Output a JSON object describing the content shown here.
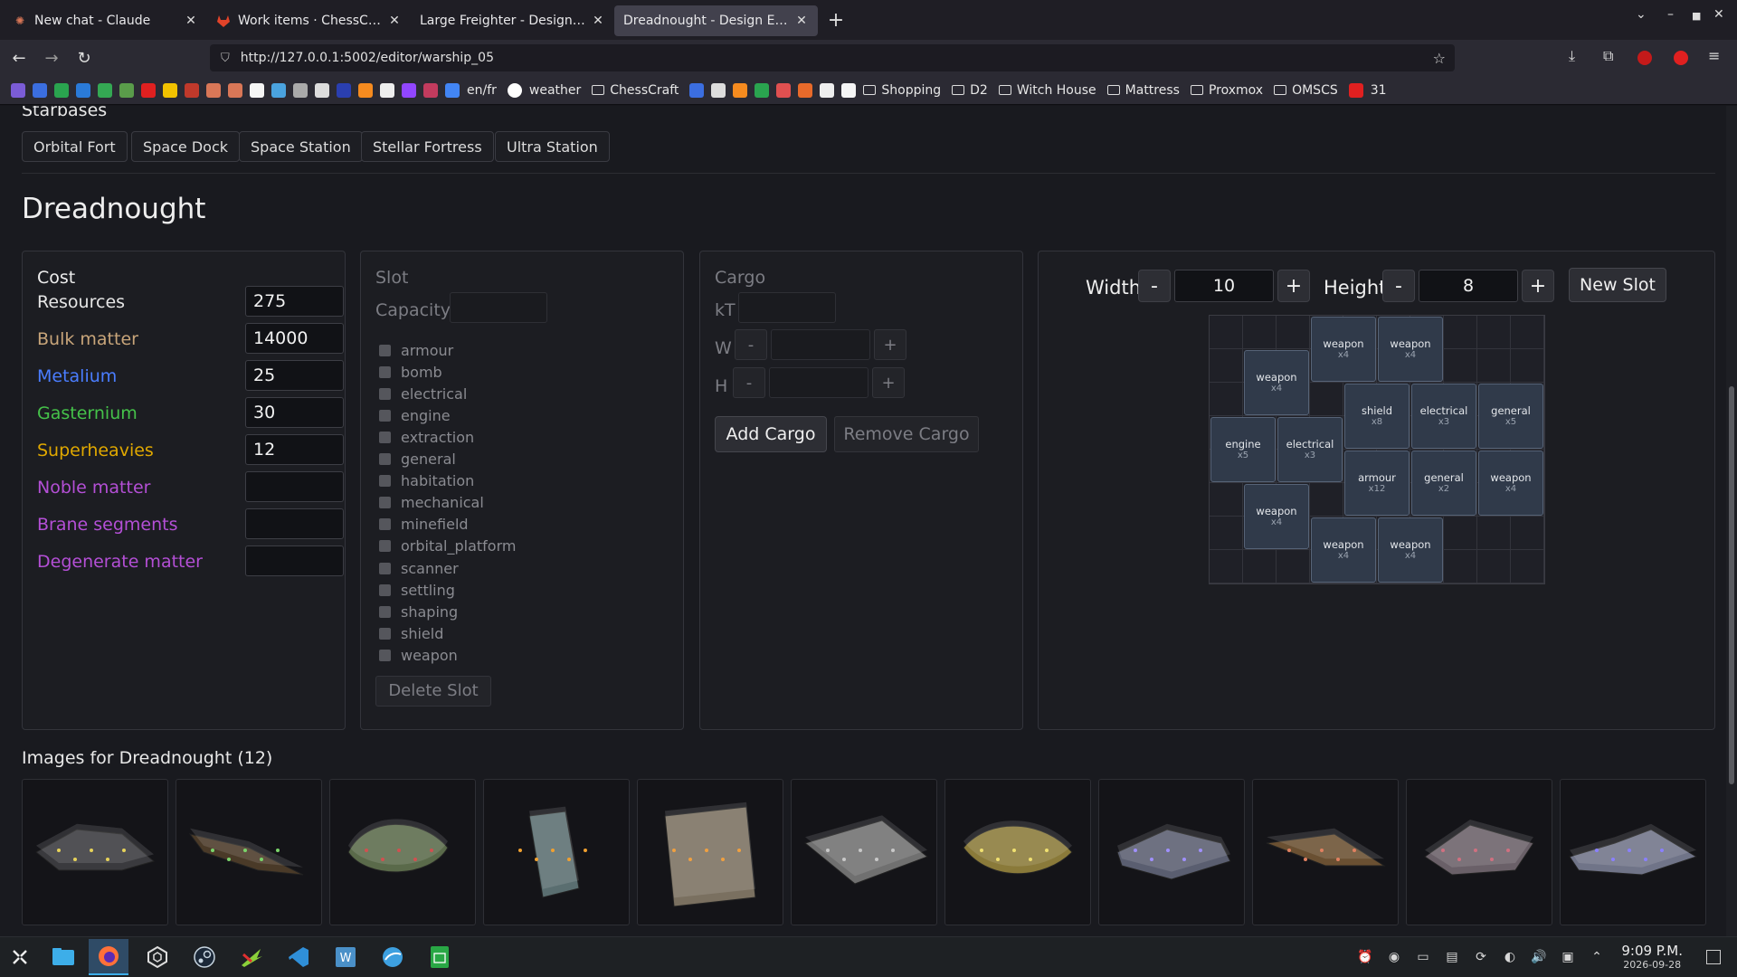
{
  "browser": {
    "tabs": [
      {
        "title": "New chat - Claude",
        "icon": "claude-icon",
        "active": false
      },
      {
        "title": "Work items · ChessCraft · G",
        "icon": "gitlab-icon",
        "active": false
      },
      {
        "title": "Large Freighter - Design Editor",
        "icon": "",
        "active": false
      },
      {
        "title": "Dreadnought - Design Editor",
        "icon": "",
        "active": true
      }
    ],
    "new_tab": "+",
    "url": "http://127.0.0.1:5002/editor/warship_05",
    "bookmarks": [
      {
        "label": "en/fr",
        "type": "link"
      },
      {
        "label": "weather",
        "type": "link"
      },
      {
        "label": "ChessCraft",
        "type": "folder"
      },
      {
        "label": "Shopping",
        "type": "folder"
      },
      {
        "label": "D2",
        "type": "folder"
      },
      {
        "label": "Witch House",
        "type": "folder"
      },
      {
        "label": "Mattress",
        "type": "folder"
      },
      {
        "label": "Proxmox",
        "type": "folder"
      },
      {
        "label": "OMSCS",
        "type": "folder"
      },
      {
        "label": "31",
        "type": "link"
      }
    ]
  },
  "starbases": {
    "heading": "Starbases",
    "items": [
      "Orbital Fort",
      "Space Dock",
      "Space Station",
      "Stellar Fortress",
      "Ultra Station"
    ]
  },
  "ship": {
    "name": "Dreadnought"
  },
  "cost": {
    "heading": "Cost",
    "rows": [
      {
        "label": "Resources",
        "value": "275",
        "color": "#e6e6e6"
      },
      {
        "label": "Bulk matter",
        "value": "14000",
        "color": "#c8a57a"
      },
      {
        "label": "Metalium",
        "value": "25",
        "color": "#4a7dff"
      },
      {
        "label": "Gasternium",
        "value": "30",
        "color": "#45c24a"
      },
      {
        "label": "Superheavies",
        "value": "12",
        "color": "#e0a800"
      },
      {
        "label": "Noble matter",
        "value": "",
        "color": "#b44fd6"
      },
      {
        "label": "Brane segments",
        "value": "",
        "color": "#b44fd6"
      },
      {
        "label": "Degenerate matter",
        "value": "",
        "color": "#b44fd6"
      }
    ]
  },
  "slot": {
    "heading": "Slot",
    "capacity_label": "Capacity",
    "types": [
      "armour",
      "bomb",
      "electrical",
      "engine",
      "extraction",
      "general",
      "habitation",
      "mechanical",
      "minefield",
      "orbital_platform",
      "scanner",
      "settling",
      "shaping",
      "shield",
      "weapon"
    ],
    "delete_label": "Delete Slot"
  },
  "cargo": {
    "heading": "Cargo",
    "kt_label": "kT",
    "w_label": "W",
    "h_label": "H",
    "minus": "-",
    "plus": "+",
    "add_label": "Add Cargo",
    "remove_label": "Remove Cargo"
  },
  "grid_editor": {
    "width_label": "Width",
    "width_value": "10",
    "height_label": "Height",
    "height_value": "8",
    "minus": "-",
    "plus": "+",
    "new_slot_label": "New Slot",
    "cols": 10,
    "rows": 8,
    "slots": [
      {
        "type": "weapon",
        "count": "x4",
        "col": 3,
        "row": 0
      },
      {
        "type": "weapon",
        "count": "x4",
        "col": 5,
        "row": 0
      },
      {
        "type": "weapon",
        "count": "x4",
        "col": 1,
        "row": 1
      },
      {
        "type": "shield",
        "count": "x8",
        "col": 4,
        "row": 2
      },
      {
        "type": "electrical",
        "count": "x3",
        "col": 6,
        "row": 2
      },
      {
        "type": "general",
        "count": "x5",
        "col": 8,
        "row": 2
      },
      {
        "type": "engine",
        "count": "x5",
        "col": 0,
        "row": 3
      },
      {
        "type": "electrical",
        "count": "x3",
        "col": 2,
        "row": 3
      },
      {
        "type": "armour",
        "count": "x12",
        "col": 4,
        "row": 4
      },
      {
        "type": "general",
        "count": "x2",
        "col": 6,
        "row": 4
      },
      {
        "type": "weapon",
        "count": "x4",
        "col": 8,
        "row": 4
      },
      {
        "type": "weapon",
        "count": "x4",
        "col": 1,
        "row": 5
      },
      {
        "type": "weapon",
        "count": "x4",
        "col": 3,
        "row": 6
      },
      {
        "type": "weapon",
        "count": "x4",
        "col": 5,
        "row": 6
      }
    ]
  },
  "images": {
    "heading": "Images for Dreadnought (12)",
    "thumbs": [
      {
        "name": "ship-image-1",
        "hull": "#3a3a3e",
        "accent": "#e6d25a"
      },
      {
        "name": "ship-image-2",
        "hull": "#4a3a28",
        "accent": "#7ad46a"
      },
      {
        "name": "ship-image-3",
        "hull": "#5a6a4a",
        "accent": "#d05050"
      },
      {
        "name": "ship-image-4",
        "hull": "#5a6e70",
        "accent": "#f0a030"
      },
      {
        "name": "ship-image-5",
        "hull": "#7a7060",
        "accent": "#f0a040"
      },
      {
        "name": "ship-image-6",
        "hull": "#707070",
        "accent": "#c8c8c8"
      },
      {
        "name": "ship-image-7",
        "hull": "#8a7a3a",
        "accent": "#f0e070"
      },
      {
        "name": "ship-image-8",
        "hull": "#5a5e70",
        "accent": "#a090ff"
      },
      {
        "name": "ship-image-9",
        "hull": "#6a5032",
        "accent": "#e08060"
      },
      {
        "name": "ship-image-10",
        "hull": "#6a6068",
        "accent": "#d07080"
      },
      {
        "name": "ship-image-11",
        "hull": "#707488",
        "accent": "#8a80ff"
      }
    ]
  },
  "taskbar": {
    "time": "9:09 P.M.",
    "date": "2026-09-28"
  }
}
